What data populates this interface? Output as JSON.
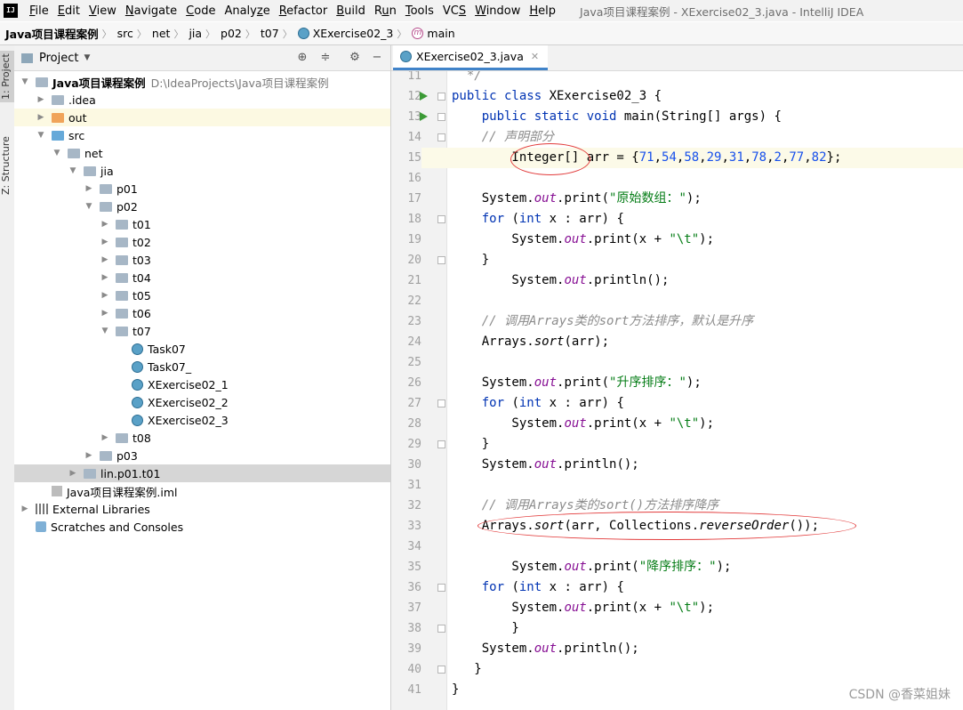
{
  "menu": {
    "items": [
      {
        "pre": "",
        "ul": "F",
        "post": "ile"
      },
      {
        "pre": "",
        "ul": "E",
        "post": "dit"
      },
      {
        "pre": "",
        "ul": "V",
        "post": "iew"
      },
      {
        "pre": "",
        "ul": "N",
        "post": "avigate"
      },
      {
        "pre": "",
        "ul": "C",
        "post": "ode"
      },
      {
        "pre": "Analy",
        "ul": "z",
        "post": "e"
      },
      {
        "pre": "",
        "ul": "R",
        "post": "efactor"
      },
      {
        "pre": "",
        "ul": "B",
        "post": "uild"
      },
      {
        "pre": "R",
        "ul": "u",
        "post": "n"
      },
      {
        "pre": "",
        "ul": "T",
        "post": "ools"
      },
      {
        "pre": "VC",
        "ul": "S",
        "post": ""
      },
      {
        "pre": "",
        "ul": "W",
        "post": "indow"
      },
      {
        "pre": "",
        "ul": "H",
        "post": "elp"
      }
    ],
    "window_title": "Java项目课程案例 - XExercise02_3.java - IntelliJ IDEA",
    "logo": "IJ"
  },
  "breadcrumb": [
    "Java项目课程案例",
    "src",
    "net",
    "jia",
    "p02",
    "t07",
    "XExercise02_3",
    "main"
  ],
  "tool_strip": {
    "project_tab": "1: Project",
    "structure_tab": "Z: Structure"
  },
  "project_panel": {
    "title": "Project",
    "tree": [
      {
        "label": "Java项目课程案例",
        "note": "D:\\IdeaProjects\\Java项目课程案例",
        "depth": 0,
        "arrow": "open",
        "icon": "module",
        "bold": true
      },
      {
        "label": ".idea",
        "depth": 1,
        "arrow": "closed",
        "icon": "folder"
      },
      {
        "label": "out",
        "depth": 1,
        "arrow": "closed",
        "icon": "folder-orange",
        "highlight": "yellow"
      },
      {
        "label": "src",
        "depth": 1,
        "arrow": "open",
        "icon": "folder-blue"
      },
      {
        "label": "net",
        "depth": 2,
        "arrow": "open",
        "icon": "folder"
      },
      {
        "label": "jia",
        "depth": 3,
        "arrow": "open",
        "icon": "folder"
      },
      {
        "label": "p01",
        "depth": 4,
        "arrow": "closed",
        "icon": "folder"
      },
      {
        "label": "p02",
        "depth": 4,
        "arrow": "open",
        "icon": "folder"
      },
      {
        "label": "t01",
        "depth": 5,
        "arrow": "closed",
        "icon": "folder"
      },
      {
        "label": "t02",
        "depth": 5,
        "arrow": "closed",
        "icon": "folder"
      },
      {
        "label": "t03",
        "depth": 5,
        "arrow": "closed",
        "icon": "folder"
      },
      {
        "label": "t04",
        "depth": 5,
        "arrow": "closed",
        "icon": "folder"
      },
      {
        "label": "t05",
        "depth": 5,
        "arrow": "closed",
        "icon": "folder"
      },
      {
        "label": "t06",
        "depth": 5,
        "arrow": "closed",
        "icon": "folder"
      },
      {
        "label": "t07",
        "depth": 5,
        "arrow": "open",
        "icon": "folder"
      },
      {
        "label": "Task07",
        "depth": 6,
        "arrow": "none",
        "icon": "class"
      },
      {
        "label": "Task07_",
        "depth": 6,
        "arrow": "none",
        "icon": "class"
      },
      {
        "label": "XExercise02_1",
        "depth": 6,
        "arrow": "none",
        "icon": "class"
      },
      {
        "label": "XExercise02_2",
        "depth": 6,
        "arrow": "none",
        "icon": "class"
      },
      {
        "label": "XExercise02_3",
        "depth": 6,
        "arrow": "none",
        "icon": "class"
      },
      {
        "label": "t08",
        "depth": 5,
        "arrow": "closed",
        "icon": "folder"
      },
      {
        "label": "p03",
        "depth": 4,
        "arrow": "closed",
        "icon": "folder"
      },
      {
        "label": "lin.p01.t01",
        "depth": 3,
        "arrow": "closed",
        "icon": "folder",
        "highlight": "gray"
      },
      {
        "label": "Java项目课程案例.iml",
        "depth": 1,
        "arrow": "none",
        "icon": "iml"
      },
      {
        "label": "External Libraries",
        "depth": 0,
        "arrow": "closed",
        "icon": "lib"
      },
      {
        "label": "Scratches and Consoles",
        "depth": 0,
        "arrow": "none",
        "icon": "scratch"
      }
    ]
  },
  "editor": {
    "tab_label": "XExercise02_3.java",
    "lines": [
      {
        "n": "11",
        "tokens": [
          {
            "t": "  */",
            "c": "cm"
          }
        ]
      },
      {
        "n": "12",
        "run": true,
        "fold": true,
        "tokens": [
          {
            "t": "public class ",
            "c": "kw"
          },
          {
            "t": "XExercise02_3 {",
            "c": ""
          }
        ]
      },
      {
        "n": "13",
        "run": true,
        "fold": true,
        "tokens": [
          {
            "t": "    public static void ",
            "c": "kw"
          },
          {
            "t": "main(String[] args) {",
            "c": ""
          }
        ]
      },
      {
        "n": "14",
        "fold": true,
        "tokens": [
          {
            "t": "    // 声明部分",
            "c": "cm"
          }
        ]
      },
      {
        "n": "15",
        "caret": true,
        "tokens": [
          {
            "t": "        Integer[] arr = {",
            "c": ""
          },
          {
            "t": "71",
            "c": "nm"
          },
          {
            "t": ",",
            "c": ""
          },
          {
            "t": "54",
            "c": "nm"
          },
          {
            "t": ",",
            "c": ""
          },
          {
            "t": "58",
            "c": "nm"
          },
          {
            "t": ",",
            "c": ""
          },
          {
            "t": "29",
            "c": "nm"
          },
          {
            "t": ",",
            "c": ""
          },
          {
            "t": "31",
            "c": "nm"
          },
          {
            "t": ",",
            "c": ""
          },
          {
            "t": "78",
            "c": "nm"
          },
          {
            "t": ",",
            "c": ""
          },
          {
            "t": "2",
            "c": "nm"
          },
          {
            "t": ",",
            "c": ""
          },
          {
            "t": "77",
            "c": "nm"
          },
          {
            "t": ",",
            "c": ""
          },
          {
            "t": "82",
            "c": "nm"
          },
          {
            "t": "};",
            "c": ""
          }
        ]
      },
      {
        "n": "16",
        "tokens": []
      },
      {
        "n": "17",
        "tokens": [
          {
            "t": "    System.",
            "c": ""
          },
          {
            "t": "out",
            "c": "fld"
          },
          {
            "t": ".print(",
            "c": ""
          },
          {
            "t": "\"原始数组：\"",
            "c": "st"
          },
          {
            "t": ");",
            "c": ""
          }
        ]
      },
      {
        "n": "18",
        "fold": true,
        "tokens": [
          {
            "t": "    for ",
            "c": "kw"
          },
          {
            "t": "(",
            "c": ""
          },
          {
            "t": "int ",
            "c": "kw"
          },
          {
            "t": "x : arr) {",
            "c": ""
          }
        ]
      },
      {
        "n": "19",
        "tokens": [
          {
            "t": "        System.",
            "c": ""
          },
          {
            "t": "out",
            "c": "fld"
          },
          {
            "t": ".print(x + ",
            "c": ""
          },
          {
            "t": "\"\\t\"",
            "c": "st"
          },
          {
            "t": ");",
            "c": ""
          }
        ]
      },
      {
        "n": "20",
        "fold": true,
        "tokens": [
          {
            "t": "    }",
            "c": ""
          }
        ]
      },
      {
        "n": "21",
        "tokens": [
          {
            "t": "        System.",
            "c": ""
          },
          {
            "t": "out",
            "c": "fld"
          },
          {
            "t": ".println();",
            "c": ""
          }
        ]
      },
      {
        "n": "22",
        "tokens": []
      },
      {
        "n": "23",
        "tokens": [
          {
            "t": "    // 调用Arrays类的sort方法排序，默认是升序",
            "c": "cm"
          }
        ]
      },
      {
        "n": "24",
        "tokens": [
          {
            "t": "    Arrays.",
            "c": ""
          },
          {
            "t": "sort",
            "c": "smeth"
          },
          {
            "t": "(arr);",
            "c": ""
          }
        ]
      },
      {
        "n": "25",
        "tokens": []
      },
      {
        "n": "26",
        "tokens": [
          {
            "t": "    System.",
            "c": ""
          },
          {
            "t": "out",
            "c": "fld"
          },
          {
            "t": ".print(",
            "c": ""
          },
          {
            "t": "\"升序排序：\"",
            "c": "st"
          },
          {
            "t": ");",
            "c": ""
          }
        ]
      },
      {
        "n": "27",
        "fold": true,
        "tokens": [
          {
            "t": "    for ",
            "c": "kw"
          },
          {
            "t": "(",
            "c": ""
          },
          {
            "t": "int ",
            "c": "kw"
          },
          {
            "t": "x : arr) {",
            "c": ""
          }
        ]
      },
      {
        "n": "28",
        "tokens": [
          {
            "t": "        System.",
            "c": ""
          },
          {
            "t": "out",
            "c": "fld"
          },
          {
            "t": ".print(x + ",
            "c": ""
          },
          {
            "t": "\"\\t\"",
            "c": "st"
          },
          {
            "t": ");",
            "c": ""
          }
        ]
      },
      {
        "n": "29",
        "fold": true,
        "tokens": [
          {
            "t": "    }",
            "c": ""
          }
        ]
      },
      {
        "n": "30",
        "tokens": [
          {
            "t": "    System.",
            "c": ""
          },
          {
            "t": "out",
            "c": "fld"
          },
          {
            "t": ".println();",
            "c": ""
          }
        ]
      },
      {
        "n": "31",
        "tokens": []
      },
      {
        "n": "32",
        "tokens": [
          {
            "t": "    // 调用Arrays类的sort()方法排序降序",
            "c": "cm"
          }
        ]
      },
      {
        "n": "33",
        "tokens": [
          {
            "t": "    Arrays.",
            "c": ""
          },
          {
            "t": "sort",
            "c": "smeth"
          },
          {
            "t": "(arr, Collections.",
            "c": ""
          },
          {
            "t": "reverseOrder",
            "c": "smeth"
          },
          {
            "t": "());",
            "c": ""
          }
        ]
      },
      {
        "n": "34",
        "tokens": []
      },
      {
        "n": "35",
        "tokens": [
          {
            "t": "        System.",
            "c": ""
          },
          {
            "t": "out",
            "c": "fld"
          },
          {
            "t": ".print(",
            "c": ""
          },
          {
            "t": "\"降序排序：\"",
            "c": "st"
          },
          {
            "t": ");",
            "c": ""
          }
        ]
      },
      {
        "n": "36",
        "fold": true,
        "tokens": [
          {
            "t": "    for ",
            "c": "kw"
          },
          {
            "t": "(",
            "c": ""
          },
          {
            "t": "int ",
            "c": "kw"
          },
          {
            "t": "x : arr) {",
            "c": ""
          }
        ]
      },
      {
        "n": "37",
        "tokens": [
          {
            "t": "        System.",
            "c": ""
          },
          {
            "t": "out",
            "c": "fld"
          },
          {
            "t": ".print(x + ",
            "c": ""
          },
          {
            "t": "\"\\t\"",
            "c": "st"
          },
          {
            "t": ");",
            "c": ""
          }
        ]
      },
      {
        "n": "38",
        "fold": true,
        "tokens": [
          {
            "t": "        }",
            "c": ""
          }
        ]
      },
      {
        "n": "39",
        "tokens": [
          {
            "t": "    System.",
            "c": ""
          },
          {
            "t": "out",
            "c": "fld"
          },
          {
            "t": ".println();",
            "c": ""
          }
        ]
      },
      {
        "n": "40",
        "fold": true,
        "tokens": [
          {
            "t": "   }",
            "c": ""
          }
        ]
      },
      {
        "n": "41",
        "tokens": [
          {
            "t": "}",
            "c": ""
          }
        ]
      }
    ]
  },
  "watermark": "CSDN @香菜姐妹",
  "colors": {
    "accent_tab": "#4083c9",
    "annotation": "#e23b3b",
    "run_icon": "#3b9a36"
  }
}
